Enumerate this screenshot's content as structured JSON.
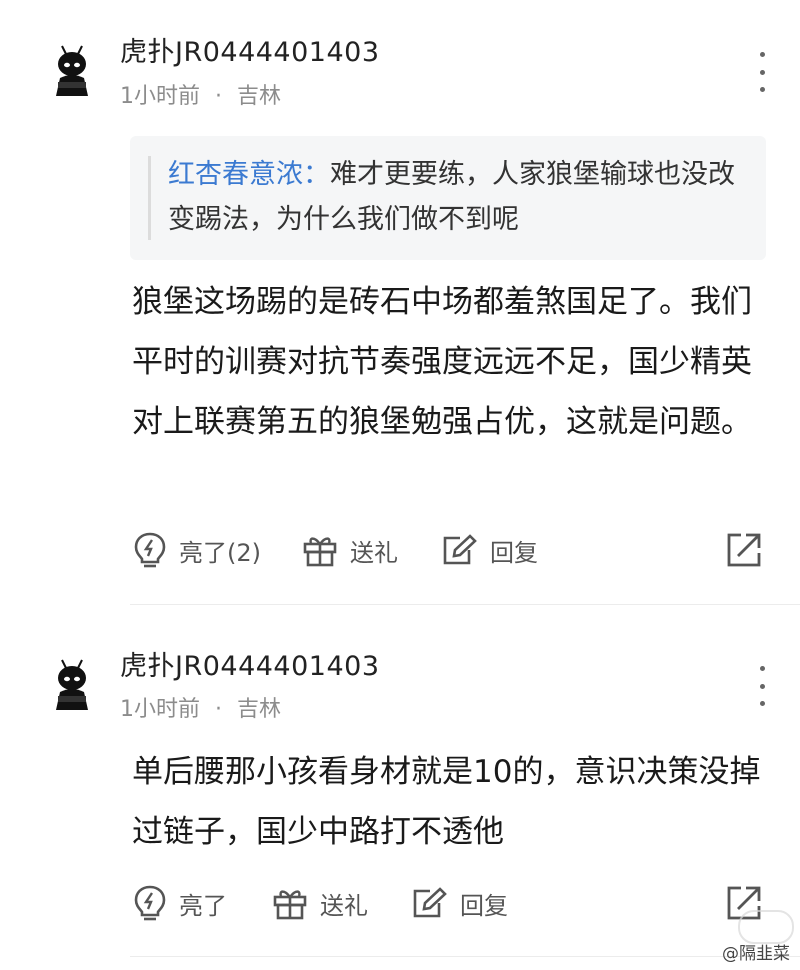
{
  "comments": [
    {
      "username": "虎扑JR0444401403",
      "time": "1小时前",
      "location": "吉林",
      "quote": {
        "author": "红杏春意浓",
        "separator": "：",
        "text": "难才更要练，人家狼堡输球也没改变踢法，为什么我们做不到呢"
      },
      "body": "狼堡这场踢的是砖石中场都羞煞国足了。我们平时的训赛对抗节奏强度远远不足，国少精英对上联赛第五的狼堡勉强占优，这就是问题。",
      "actions": {
        "like": "亮了(2)",
        "gift": "送礼",
        "reply": "回复"
      }
    },
    {
      "username": "虎扑JR0444401403",
      "time": "1小时前",
      "location": "吉林",
      "body": "单后腰那小孩看身材就是10的，意识决策没掉过链子，国少中路打不透他",
      "actions": {
        "like": "亮了",
        "gift": "送礼",
        "reply": "回复"
      }
    }
  ],
  "meta_separator": "·",
  "watermark": "@隔韭菜",
  "colors": {
    "quote_author": "#3b7ad1",
    "meta": "#8c8c8c",
    "icon": "#555555"
  },
  "icons": [
    "avatar",
    "more-icon",
    "lightbulb-icon",
    "gift-icon",
    "edit-icon",
    "share-icon"
  ]
}
